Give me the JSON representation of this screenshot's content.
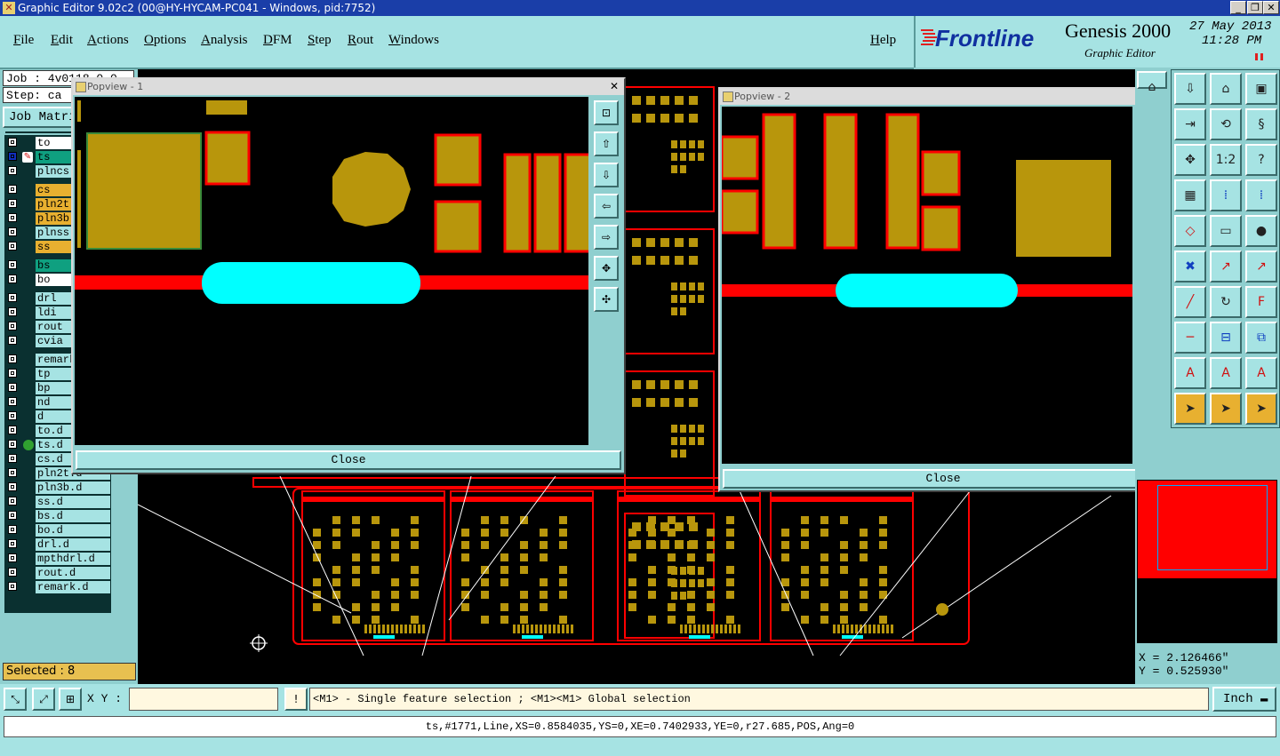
{
  "window": {
    "title": "Graphic Editor 9.02c2 (00@HY-HYCAM-PC041 - Windows, pid:7752)",
    "min_glyph": "_",
    "max_glyph": "❐",
    "close_glyph": "✕"
  },
  "menubar": {
    "items": [
      "File",
      "Edit",
      "Actions",
      "Options",
      "Analysis",
      "DFM",
      "Step",
      "Rout",
      "Windows"
    ],
    "help": "Help"
  },
  "brand": {
    "logo": "Frontline",
    "product": "Genesis 2000",
    "subtitle": "Graphic Editor",
    "date": "27 May 2013",
    "time": "11:28 PM"
  },
  "left": {
    "job": "Job : 4v0118.0.0",
    "step": "Step: ca",
    "job_matrix_button": "Job Matrix",
    "selected": "Selected : 8"
  },
  "layers": [
    {
      "name": "to",
      "color": "#ffffff"
    },
    {
      "name": "ts",
      "color": "#0fa080",
      "active": true
    },
    {
      "name": "plncs",
      "color": "#a6e3e3"
    },
    {
      "name": "cs",
      "color": "#e8b030"
    },
    {
      "name": "pln2t",
      "color": "#e8b030"
    },
    {
      "name": "pln3b",
      "color": "#e8b030"
    },
    {
      "name": "plnss",
      "color": "#a6e3e3"
    },
    {
      "name": "ss",
      "color": "#e8b030"
    },
    {
      "name": "bs",
      "color": "#0fa080"
    },
    {
      "name": "bo",
      "color": "#ffffff"
    },
    {
      "name": "drl",
      "color": "#a6e3e3"
    },
    {
      "name": "ldi",
      "color": "#a6e3e3"
    },
    {
      "name": "rout",
      "color": "#a6e3e3"
    },
    {
      "name": "cvia",
      "color": "#a6e3e3"
    },
    {
      "name": "remark",
      "color": "#a6e3e3"
    },
    {
      "name": "tp",
      "color": "#a6e3e3"
    },
    {
      "name": "bp",
      "color": "#a6e3e3"
    },
    {
      "name": "nd",
      "color": "#a6e3e3"
    },
    {
      "name": "d",
      "color": "#a6e3e3"
    },
    {
      "name": "to.d",
      "color": "#a6e3e3"
    },
    {
      "name": "ts.d",
      "color": "#a6e3e3"
    },
    {
      "name": "cs.d",
      "color": "#a6e3e3"
    },
    {
      "name": "pln2t.d",
      "color": "#a6e3e3"
    },
    {
      "name": "pln3b.d",
      "color": "#a6e3e3"
    },
    {
      "name": "ss.d",
      "color": "#a6e3e3"
    },
    {
      "name": "bs.d",
      "color": "#a6e3e3"
    },
    {
      "name": "bo.d",
      "color": "#a6e3e3"
    },
    {
      "name": "drl.d",
      "color": "#a6e3e3"
    },
    {
      "name": "mpthdrl.d",
      "color": "#a6e3e3"
    },
    {
      "name": "rout.d",
      "color": "#a6e3e3"
    },
    {
      "name": "remark.d",
      "color": "#a6e3e3"
    }
  ],
  "popview1": {
    "title": "Popview - 1",
    "close_label": "Close",
    "x_glyph": "✕"
  },
  "popview2": {
    "title": "Popview - 2",
    "close_label": "Close",
    "x_glyph": "✕"
  },
  "right": {
    "coord_x": "X = 2.126466\"",
    "coord_y": "Y = 0.525930\"",
    "ratio_label": "1:2"
  },
  "bottom": {
    "xy_label": "X Y :",
    "xy_value": "",
    "warn_glyph": "!",
    "message": "<M1> - Single feature selection ; <M1><M1> Global selection",
    "units": "Inch",
    "status": "ts,#1771,Line,XS=0.8584035,YS=0,XE=0.7402933,YE=0,r27.685,POS,Ang=0"
  },
  "colors": {
    "copper": "#b8960c",
    "red": "#ff0000",
    "cyan": "#00ffff",
    "panel": "#8fcfcf"
  }
}
